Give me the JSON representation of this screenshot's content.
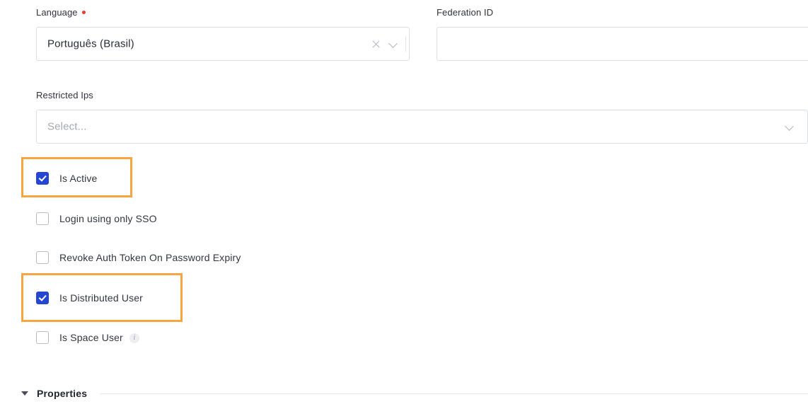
{
  "form": {
    "language": {
      "label": "Language",
      "required": true,
      "value": "Português (Brasil)",
      "clear_icon": "close-x-icon",
      "dropdown_icon": "chevron-down-icon"
    },
    "federation_id": {
      "label": "Federation ID",
      "value": "",
      "placeholder": ""
    },
    "restricted_ips": {
      "label": "Restricted Ips",
      "value": "",
      "placeholder": "Select...",
      "dropdown_icon": "chevron-down-icon"
    },
    "checkboxes": [
      {
        "label": "Is Active",
        "checked": true,
        "info": false
      },
      {
        "label": "Login using only SSO",
        "checked": false,
        "info": false
      },
      {
        "label": "Revoke Auth Token On Password Expiry",
        "checked": false,
        "info": false
      },
      {
        "label": "Is Distributed User",
        "checked": true,
        "info": false
      },
      {
        "label": "Is Space User",
        "checked": false,
        "info": true,
        "info_icon": "info-icon"
      }
    ],
    "section": {
      "title": "Properties",
      "expanded": true,
      "caret_icon": "caret-down-icon"
    }
  },
  "annotations": {
    "highlight_color": "#f7a543",
    "boxes": [
      {
        "target": "Is Active"
      },
      {
        "target": "Is Distributed User"
      }
    ]
  },
  "colors": {
    "checkbox_checked": "#2545d3",
    "required_marker": "#e8392e",
    "highlight": "#f7a543",
    "border": "#dcdee5"
  }
}
